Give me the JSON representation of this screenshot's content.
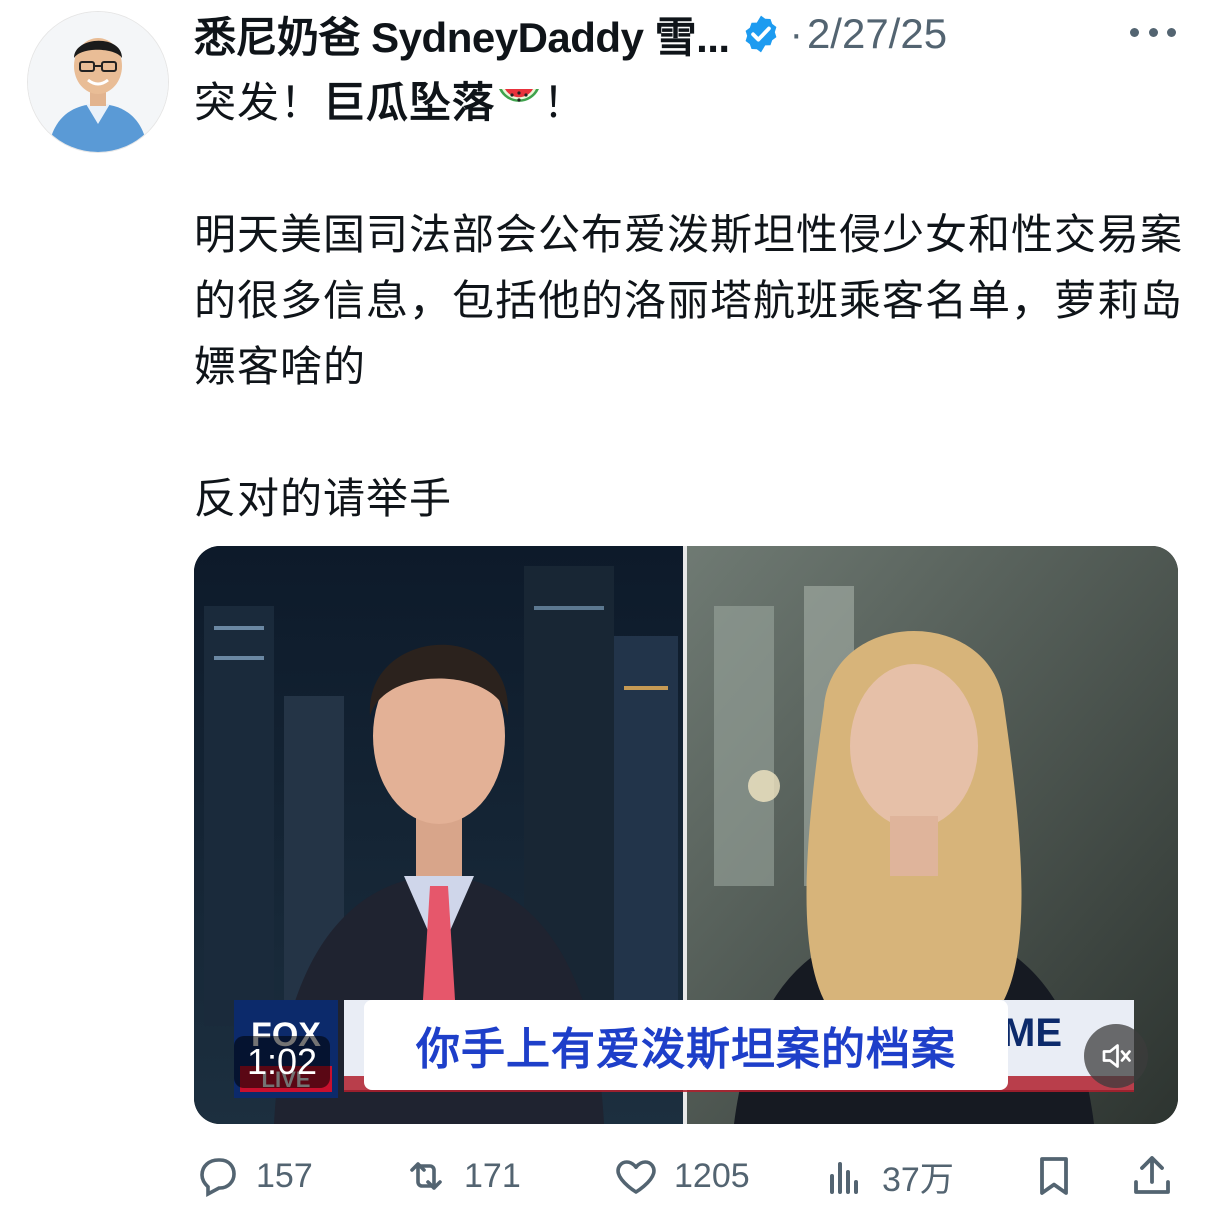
{
  "post": {
    "author_name": "悉尼奶爸 SydneyDaddy 雪...",
    "separator": "·",
    "date": "2/27/25",
    "lines": {
      "headline_prefix": "突发！",
      "headline_bold": "巨瓜坠落",
      "headline_suffix": "！",
      "paragraph_1": "明天美国司法部会公布爱泼斯坦性侵少女和性交易案的很多信息，包括他的洛丽塔航班乘客名单，萝莉岛嫖客啥的",
      "paragraph_2": "反对的请举手"
    }
  },
  "video": {
    "duration": "1:02",
    "subtitle": "你手上有爱泼斯坦案的档案",
    "network_logo_text": "FOX",
    "network_live_text": "LIVE",
    "ticker_fragment": "ME"
  },
  "actions": {
    "replies": "157",
    "reposts": "171",
    "likes": "1205",
    "views": "37万"
  },
  "colors": {
    "verified": "#1d9bf0",
    "muted_text": "#536471",
    "subtitle_text": "#1e3fc9"
  },
  "icons": [
    "verified-badge-icon",
    "more-icon",
    "watermelon-emoji-icon",
    "mute-icon",
    "reply-icon",
    "repost-icon",
    "like-icon",
    "views-icon",
    "bookmark-icon",
    "share-icon"
  ]
}
